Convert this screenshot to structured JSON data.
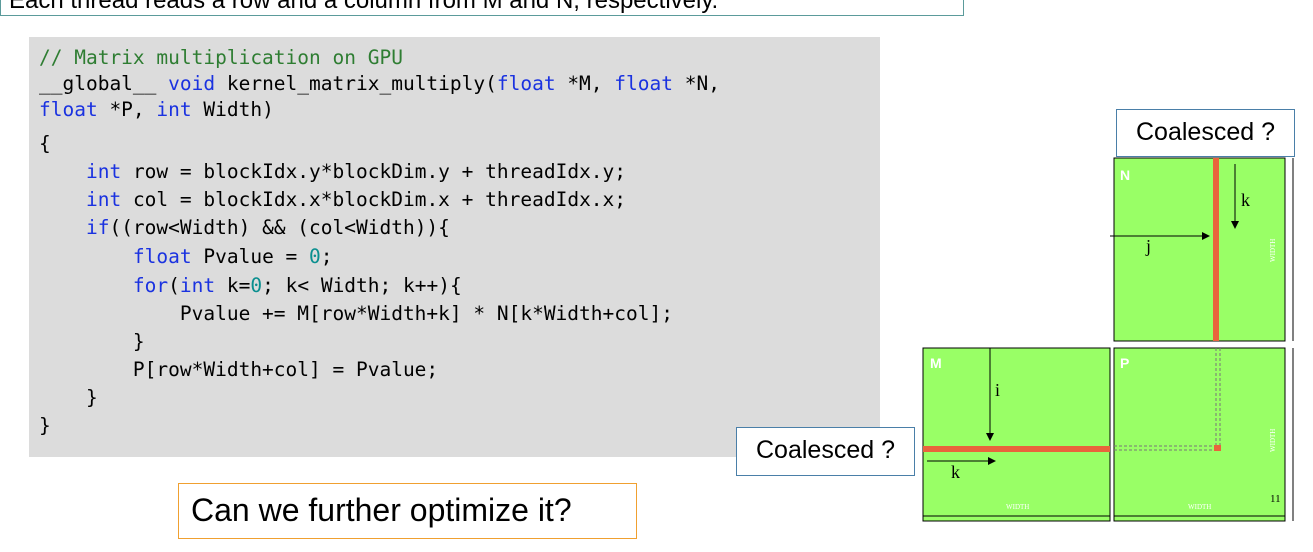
{
  "header": {
    "text": "Each thread reads a row and a column from M and N, respectively."
  },
  "code": {
    "comment": "// Matrix multiplication on GPU",
    "line2_global": "__global__ ",
    "line2_void": "void",
    "line2_sig": " kernel_matrix_multiply(",
    "kw_float": "float",
    "line2_m": " *M, ",
    "line2_n": " *N,",
    "line3_p": " *P, ",
    "kw_int": "int",
    "line3_width": " Width)",
    "brace_open": "{",
    "indent1": "    ",
    "line5_rest": " row = blockIdx.y*blockDim.y + threadIdx.y;",
    "line6_rest": " col = blockIdx.x*blockDim.x + threadIdx.x;",
    "kw_if": "if",
    "line7_rest": "((row<Width) && (col<Width)){",
    "indent2": "        ",
    "line8_mid": " Pvalue = ",
    "zero": "0",
    "semicolon": ";",
    "kw_for": "for",
    "paren_open": "(",
    "line9_k": " k=",
    "line9_rest": "; k< Width; k++){",
    "line10": "            Pvalue += M[row*Width+k] * N[k*Width+col];",
    "line11": "        }",
    "line12": "        P[row*Width+col] = Pvalue;",
    "line13": "    }",
    "brace_close": "}"
  },
  "callouts": {
    "optimize": "Can we further optimize it?",
    "coalesced_left": "Coalesced ?",
    "coalesced_right": "Coalesced ?"
  },
  "diagram": {
    "label_n": "N",
    "label_m": "M",
    "label_p": "P",
    "label_k_top": "k",
    "label_j": "j",
    "label_i": "i",
    "label_k_left": "k",
    "width_label": "WIDTH",
    "page_number": "11",
    "colors": {
      "matrix_fill": "#99ff66",
      "highlight": "#e8643c",
      "outline": "#000000"
    }
  }
}
